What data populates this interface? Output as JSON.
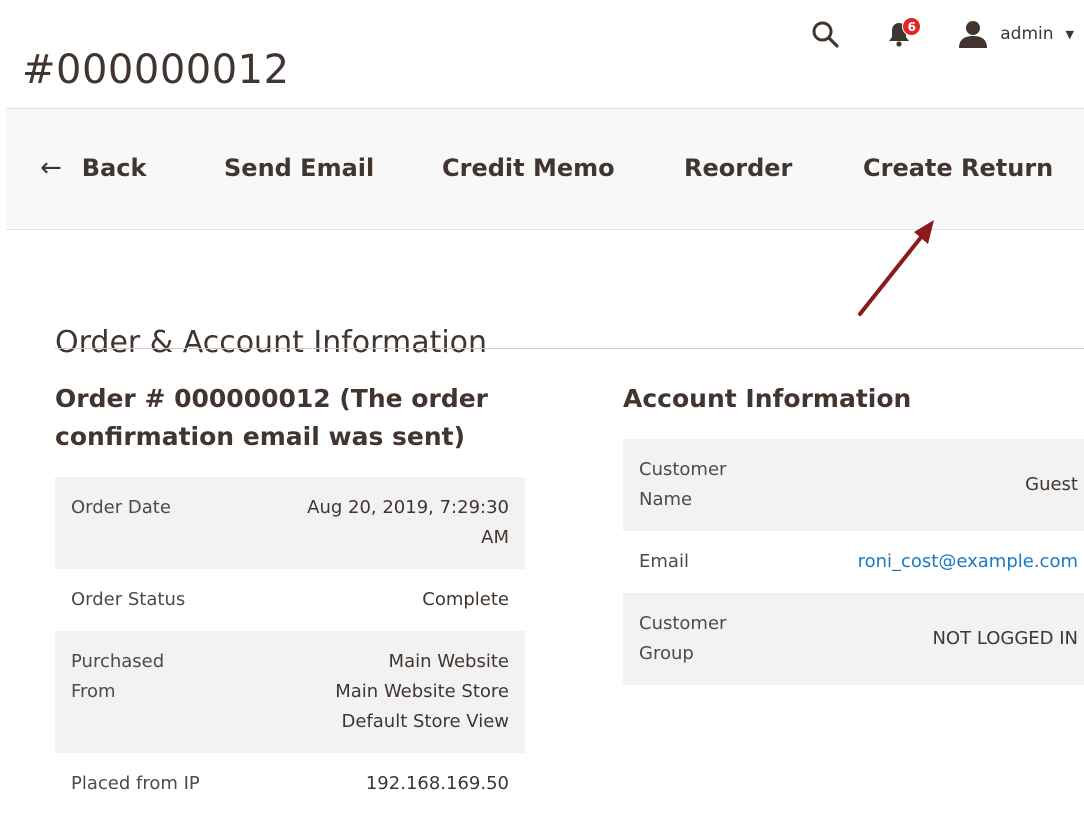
{
  "header": {
    "title": "#000000012",
    "notification_count": "6",
    "user_name": "admin"
  },
  "toolbar": {
    "back_label": "Back",
    "send_email_label": "Send Email",
    "credit_memo_label": "Credit Memo",
    "reorder_label": "Reorder",
    "create_return_label": "Create Return"
  },
  "section": {
    "title": "Order & Account Information"
  },
  "order": {
    "heading": "Order # 000000012 (The order confirmation email was sent)",
    "rows": [
      {
        "label": "Order Date",
        "value_line1": "Aug 20, 2019, 7:29:30",
        "value_line2": "AM"
      },
      {
        "label": "Order Status",
        "value_line1": "Complete"
      },
      {
        "label_line1": "Purchased",
        "label_line2": "From",
        "value_line1": "Main Website",
        "value_line2": "Main Website Store",
        "value_line3": "Default Store View"
      },
      {
        "label": "Placed from IP",
        "value_line1": "192.168.169.50"
      }
    ]
  },
  "account": {
    "heading": "Account Information",
    "rows": [
      {
        "label_line1": "Customer",
        "label_line2": "Name",
        "value": "Guest"
      },
      {
        "label": "Email",
        "value": "roni_cost@example.com"
      },
      {
        "label_line1": "Customer",
        "label_line2": "Group",
        "value": "NOT LOGGED IN"
      }
    ]
  },
  "colors": {
    "text": "#41362f",
    "link": "#1979c3",
    "badge": "#e22626",
    "annotation_arrow": "#8b1a1a",
    "toolbar_bg": "#f8f8f8",
    "row_stripe": "#f2f2f2"
  },
  "icons": {
    "search": "search-icon",
    "notifications": "bell-icon",
    "user": "user-icon",
    "back": "arrow-left-icon"
  }
}
